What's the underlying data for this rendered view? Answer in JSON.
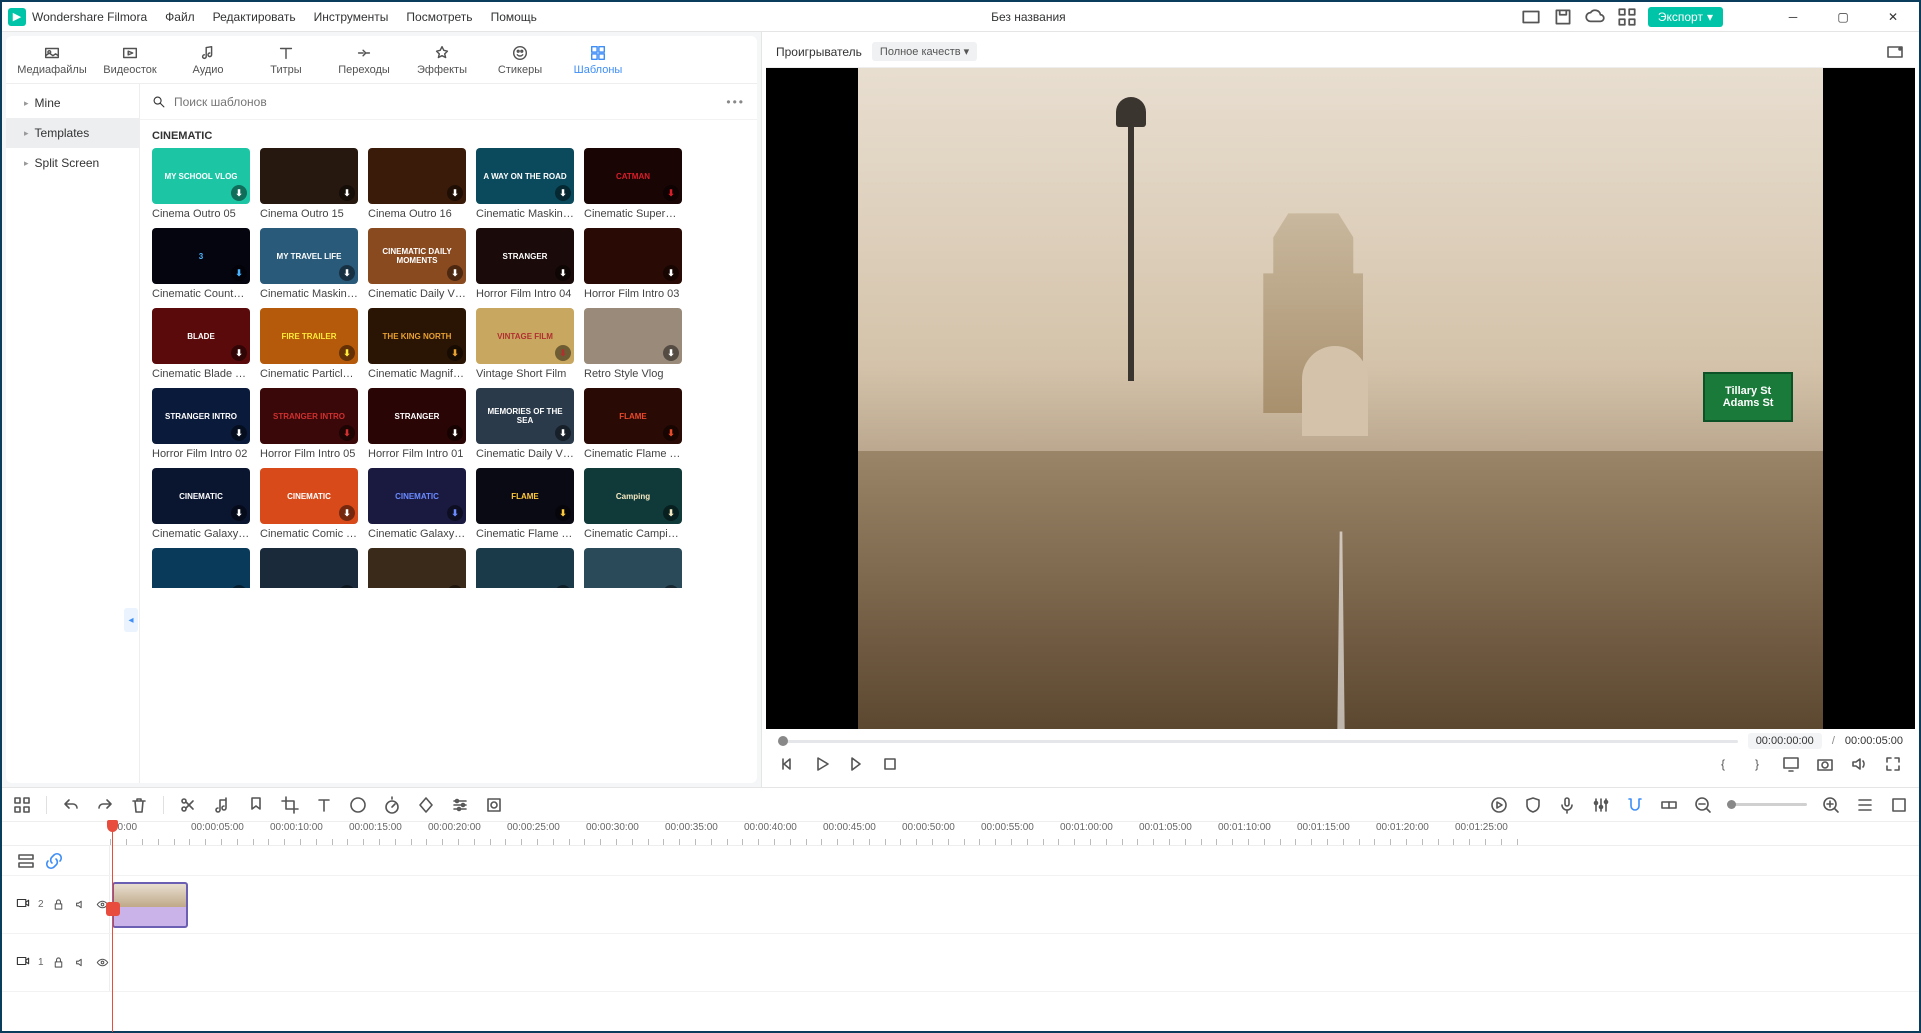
{
  "app": {
    "name": "Wondershare Filmora",
    "project_title": "Без названия",
    "export_label": "Экспорт"
  },
  "menu": [
    "Файл",
    "Редактировать",
    "Инструменты",
    "Посмотреть",
    "Помощь"
  ],
  "tabs": [
    {
      "label": "Медиафайлы",
      "icon": "media-icon"
    },
    {
      "label": "Видеосток",
      "icon": "stock-icon"
    },
    {
      "label": "Аудио",
      "icon": "audio-icon"
    },
    {
      "label": "Титры",
      "icon": "titles-icon"
    },
    {
      "label": "Переходы",
      "icon": "transitions-icon"
    },
    {
      "label": "Эффекты",
      "icon": "effects-icon"
    },
    {
      "label": "Стикеры",
      "icon": "stickers-icon"
    },
    {
      "label": "Шаблоны",
      "icon": "templates-icon"
    }
  ],
  "active_tab": 7,
  "sidebar": {
    "items": [
      {
        "label": "Mine"
      },
      {
        "label": "Templates"
      },
      {
        "label": "Split Screen"
      }
    ],
    "active": 1
  },
  "search": {
    "placeholder": "Поиск шаблонов"
  },
  "category_title": "CINEMATIC",
  "templates": [
    {
      "label": "Cinema Outro 05",
      "bg": "#1cc6a5",
      "text": "MY SCHOOL VLOG"
    },
    {
      "label": "Cinema Outro 15",
      "bg": "#26180f",
      "text": ""
    },
    {
      "label": "Cinema Outro 16",
      "bg": "#3a1a08",
      "text": ""
    },
    {
      "label": "Cinematic Masking Vl...",
      "bg": "#0a4a5c",
      "text": "A WAY ON THE ROAD"
    },
    {
      "label": "Cinematic Superhero ...",
      "bg": "#1a0505",
      "text": "CATMAN",
      "textColor": "#d91e2a"
    },
    {
      "label": "Cinematic Countdown",
      "bg": "#050510",
      "text": "3",
      "textColor": "#4ab3ff"
    },
    {
      "label": "Cinematic Masking Vl...",
      "bg": "#2a5a7a",
      "text": "MY TRAVEL LIFE"
    },
    {
      "label": "Cinematic Daily Vlog 01",
      "bg": "#8a4a20",
      "text": "CINEMATIC DAILY MOMENTS"
    },
    {
      "label": "Horror Film Intro 04",
      "bg": "#1a0a0a",
      "text": "STRANGER"
    },
    {
      "label": "Horror Film Intro 03",
      "bg": "#2a0a05",
      "text": ""
    },
    {
      "label": "Cinematic Blade Trailer",
      "bg": "#5a0a0a",
      "text": "BLADE"
    },
    {
      "label": "Cinematic Particle Trai...",
      "bg": "#b55a0a",
      "text": "FIRE TRAILER",
      "textColor": "#ffea3a"
    },
    {
      "label": "Cinematic Magnificen...",
      "bg": "#2a1505",
      "text": "THE KING NORTH",
      "textColor": "#e8a030"
    },
    {
      "label": "Vintage Short Film",
      "bg": "#c8a860",
      "text": "VINTAGE FILM",
      "textColor": "#b03030"
    },
    {
      "label": "Retro Style Vlog",
      "bg": "#9a8a7a",
      "text": ""
    },
    {
      "label": "Horror Film Intro 02",
      "bg": "#0a1a3a",
      "text": "STRANGER INTRO"
    },
    {
      "label": "Horror Film Intro 05",
      "bg": "#3a0808",
      "text": "STRANGER INTRO",
      "textColor": "#d03030"
    },
    {
      "label": "Horror Film Intro 01",
      "bg": "#2a0505",
      "text": "STRANGER"
    },
    {
      "label": "Cinematic Daily Vlog 02",
      "bg": "#2a3a4a",
      "text": "MEMORIES OF THE SEA"
    },
    {
      "label": "Cinematic Flame Trail...",
      "bg": "#2a0a05",
      "text": "FLAME",
      "textColor": "#e84a2a"
    },
    {
      "label": "Cinematic Galaxy Trail...",
      "bg": "#0a1530",
      "text": "CINEMATIC"
    },
    {
      "label": "Cinematic Comic Trailer",
      "bg": "#d84a1a",
      "text": "CINEMATIC"
    },
    {
      "label": "Cinematic Galaxy Trail...",
      "bg": "#1a1a40",
      "text": "CINEMATIC",
      "textColor": "#6a8aff"
    },
    {
      "label": "Cinematic Flame Trail...",
      "bg": "#0a0a15",
      "text": "FLAME",
      "textColor": "#ffca3a"
    },
    {
      "label": "Cinematic Camping V...",
      "bg": "#103a3a",
      "text": "Camping",
      "textColor": "#f5e8c0"
    },
    {
      "label": "",
      "bg": "#0a3a5a",
      "text": ""
    },
    {
      "label": "",
      "bg": "#1a2a3a",
      "text": ""
    },
    {
      "label": "",
      "bg": "#3a2a1a",
      "text": ""
    },
    {
      "label": "",
      "bg": "#1a3a4a",
      "text": ""
    },
    {
      "label": "",
      "bg": "#2a4a5a",
      "text": ""
    }
  ],
  "player": {
    "title": "Проигрыватель",
    "quality": "Полное качеств",
    "current_time": "00:00:00:00",
    "total_time": "00:00:05:00",
    "sign_line1": "Tillary St",
    "sign_line2": "Adams St"
  },
  "ruler_ticks": [
    "00:00",
    "00:00:05:00",
    "00:00:10:00",
    "00:00:15:00",
    "00:00:20:00",
    "00:00:25:00",
    "00:00:30:00",
    "00:00:35:00",
    "00:00:40:00",
    "00:00:45:00",
    "00:00:50:00",
    "00:00:55:00",
    "00:01:00:00",
    "00:01:05:00",
    "00:01:10:00",
    "00:01:15:00",
    "00:01:20:00",
    "00:01:25:00"
  ],
  "tracks": [
    {
      "num": "2",
      "has_clip": true
    },
    {
      "num": "1",
      "has_clip": false
    }
  ]
}
